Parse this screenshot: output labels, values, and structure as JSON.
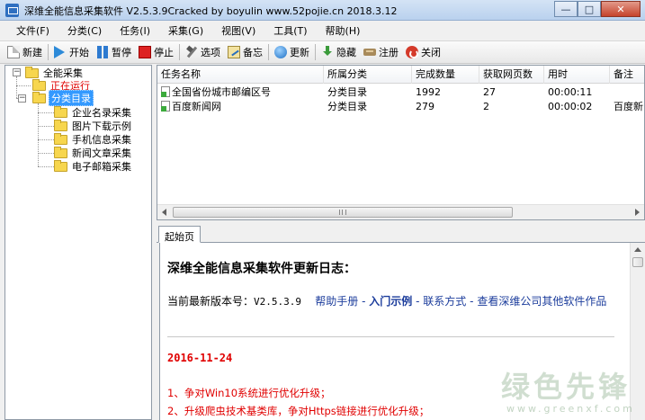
{
  "window": {
    "title": "深维全能信息采集软件 V2.5.3.9Cracked by boyulin www.52pojie.cn 2018.3.12",
    "controls": {
      "minimize": "—",
      "maximize": "□",
      "close": "✕"
    }
  },
  "menu": [
    {
      "label": "文件(F)"
    },
    {
      "label": "分类(C)"
    },
    {
      "label": "任务(I)"
    },
    {
      "label": "采集(G)"
    },
    {
      "label": "视图(V)"
    },
    {
      "label": "工具(T)"
    },
    {
      "label": "帮助(H)"
    }
  ],
  "toolbar": {
    "new_label": "新建",
    "start_label": "开始",
    "pause_label": "暂停",
    "stop_label": "停止",
    "options_label": "选项",
    "memo_label": "备忘",
    "update_label": "更新",
    "hide_label": "隐藏",
    "register_label": "注册",
    "close_label": "关闭"
  },
  "tree": {
    "root": "全能采集",
    "running": "正在运行",
    "category": "分类目录",
    "children": [
      "企业名录采集",
      "图片下载示例",
      "手机信息采集",
      "新闻文章采集",
      "电子邮箱采集"
    ]
  },
  "task_list": {
    "columns": [
      "任务名称",
      "所属分类",
      "完成数量",
      "获取网页数",
      "用时",
      "备注"
    ],
    "rows": [
      {
        "name": "全国省份城市邮编区号",
        "category": "分类目录",
        "done": "1992",
        "pages": "27",
        "time": "00:00:11",
        "note": ""
      },
      {
        "name": "百度新闻网",
        "category": "分类目录",
        "done": "279",
        "pages": "2",
        "time": "00:00:02",
        "note": "百度新闻"
      }
    ]
  },
  "browser": {
    "tab_label": "起始页",
    "heading": "深维全能信息采集软件更新日志：",
    "version_prefix": "当前最新版本号：",
    "version": "V2.5.3.9",
    "link_help": "帮助手册",
    "link_examples": "入门示例",
    "link_contact": "联系方式",
    "link_more": "查看深维公司其他软件作品",
    "separator": "-",
    "date": "2016-11-24",
    "changes": [
      "1、争对Win10系统进行优化升级；",
      "2、升级爬虫技术基类库，争对Https链接进行优化升级；"
    ]
  },
  "watermark": {
    "text": "绿色先锋",
    "url": "www.greenxf.com"
  }
}
